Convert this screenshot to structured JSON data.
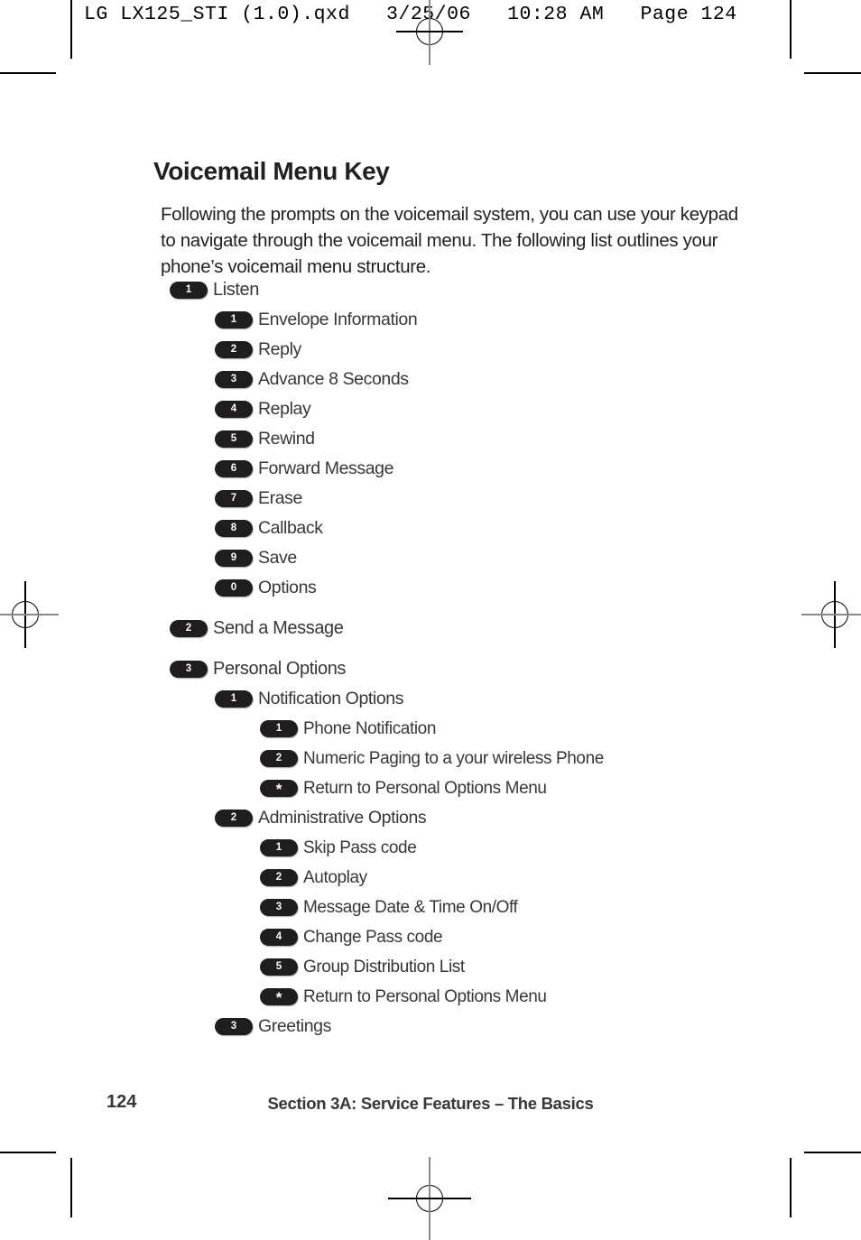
{
  "slug": {
    "text": "LG LX125_STI (1.0).qxd   3/25/06   10:28 AM   Page 124"
  },
  "page": {
    "heading": "Voicemail Menu Key",
    "intro": "Following the prompts on the voicemail system, you can use your keypad to navigate through the voicemail menu. The following list outlines your phone’s voicemail menu structure."
  },
  "menu": {
    "rows": [
      {
        "level": 1,
        "key": "1",
        "label": "Listen",
        "gap": false
      },
      {
        "level": 2,
        "key": "1",
        "label": "Envelope Information",
        "gap": false
      },
      {
        "level": 2,
        "key": "2",
        "label": "Reply",
        "gap": false
      },
      {
        "level": 2,
        "key": "3",
        "label": "Advance 8 Seconds",
        "gap": false
      },
      {
        "level": 2,
        "key": "4",
        "label": "Replay",
        "gap": false
      },
      {
        "level": 2,
        "key": "5",
        "label": "Rewind",
        "gap": false
      },
      {
        "level": 2,
        "key": "6",
        "label": "Forward Message",
        "gap": false
      },
      {
        "level": 2,
        "key": "7",
        "label": "Erase",
        "gap": false
      },
      {
        "level": 2,
        "key": "8",
        "label": "Callback",
        "gap": false
      },
      {
        "level": 2,
        "key": "9",
        "label": "Save",
        "gap": false
      },
      {
        "level": 2,
        "key": "0",
        "label": "Options",
        "gap": false
      },
      {
        "level": 1,
        "key": "2",
        "label": "Send a Message",
        "gap": true
      },
      {
        "level": 1,
        "key": "3",
        "label": "Personal Options",
        "gap": true
      },
      {
        "level": 2,
        "key": "1",
        "label": "Notification Options",
        "gap": false
      },
      {
        "level": 3,
        "key": "1",
        "label": "Phone Notification",
        "gap": false
      },
      {
        "level": 3,
        "key": "2",
        "label": "Numeric Paging to a your wireless Phone",
        "gap": false
      },
      {
        "level": 3,
        "key": "*",
        "label": "Return to Personal Options Menu",
        "gap": false
      },
      {
        "level": 2,
        "key": "2",
        "label": "Administrative Options",
        "gap": false
      },
      {
        "level": 3,
        "key": "1",
        "label": "Skip Pass code",
        "gap": false
      },
      {
        "level": 3,
        "key": "2",
        "label": "Autoplay",
        "gap": false
      },
      {
        "level": 3,
        "key": "3",
        "label": "Message Date & Time On/Off",
        "gap": false
      },
      {
        "level": 3,
        "key": "4",
        "label": "Change Pass code",
        "gap": false
      },
      {
        "level": 3,
        "key": "5",
        "label": "Group Distribution List",
        "gap": false
      },
      {
        "level": 3,
        "key": "*",
        "label": "Return to Personal Options Menu",
        "gap": false
      },
      {
        "level": 2,
        "key": "3",
        "label": "Greetings",
        "gap": false
      }
    ]
  },
  "footer": {
    "page_number": "124",
    "section": "Section 3A: Service Features – The Basics"
  },
  "colors": {
    "key_fill": "#1f1d1e",
    "key_text": "#ffffff",
    "body_text": "#3a3637",
    "heading_text": "#231f20",
    "crop_mark": "#000000"
  }
}
